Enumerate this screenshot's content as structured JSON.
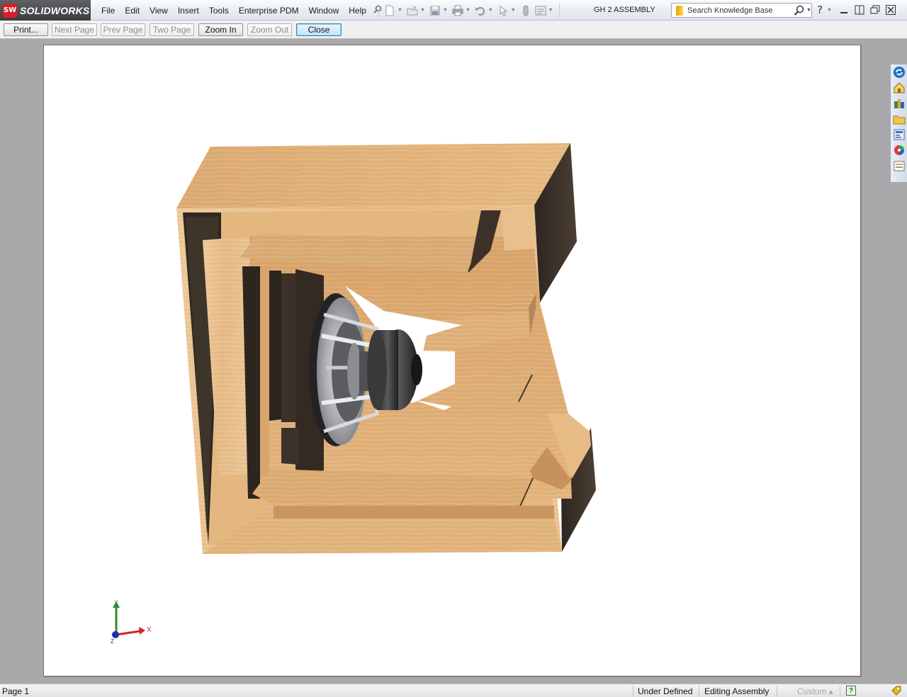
{
  "app": {
    "logo_mark": "SW",
    "logo_text": "SOLIDWORKS",
    "document_title": "GH 2 ASSEMBLY"
  },
  "menu": {
    "items": [
      "File",
      "Edit",
      "View",
      "Insert",
      "Tools",
      "Enterprise PDM",
      "Window",
      "Help"
    ]
  },
  "toolbar_icons": [
    "pin-icon",
    "new-document-icon",
    "open-icon",
    "save-icon",
    "print-icon",
    "undo-icon",
    "select-icon",
    "rebuild-icon",
    "options-icon"
  ],
  "search": {
    "placeholder": "Search Knowledge Base"
  },
  "print_preview": {
    "buttons": [
      {
        "id": "print",
        "label": "Print...",
        "enabled": true
      },
      {
        "id": "next-page",
        "label": "Next Page",
        "enabled": false
      },
      {
        "id": "prev-page",
        "label": "Prev Page",
        "enabled": false
      },
      {
        "id": "two-page",
        "label": "Two Page",
        "enabled": false
      },
      {
        "id": "zoom-in",
        "label": "Zoom In",
        "enabled": true
      },
      {
        "id": "zoom-out",
        "label": "Zoom Out",
        "enabled": false
      },
      {
        "id": "close",
        "label": "Close",
        "enabled": true
      }
    ]
  },
  "triad": {
    "x_label": "X",
    "y_label": "Y",
    "z_label": "Z"
  },
  "task_pane": {
    "icons": [
      "solidworks-resources-icon",
      "home-icon",
      "design-library-icon",
      "file-explorer-icon",
      "view-palette-icon",
      "appearances-icon",
      "custom-properties-icon"
    ]
  },
  "status": {
    "page": "Page 1",
    "definition": "Under Defined",
    "mode": "Editing Assembly",
    "units": "Custom",
    "help": "?"
  },
  "colors": {
    "wood_light": "#e9c08f",
    "wood_mid": "#d9a66e",
    "wood_dark_interior": "#3a3128",
    "speaker_gray": "#9a9ca0",
    "page_bg": "#ffffff",
    "viewport_bg": "#a9a9ab"
  }
}
